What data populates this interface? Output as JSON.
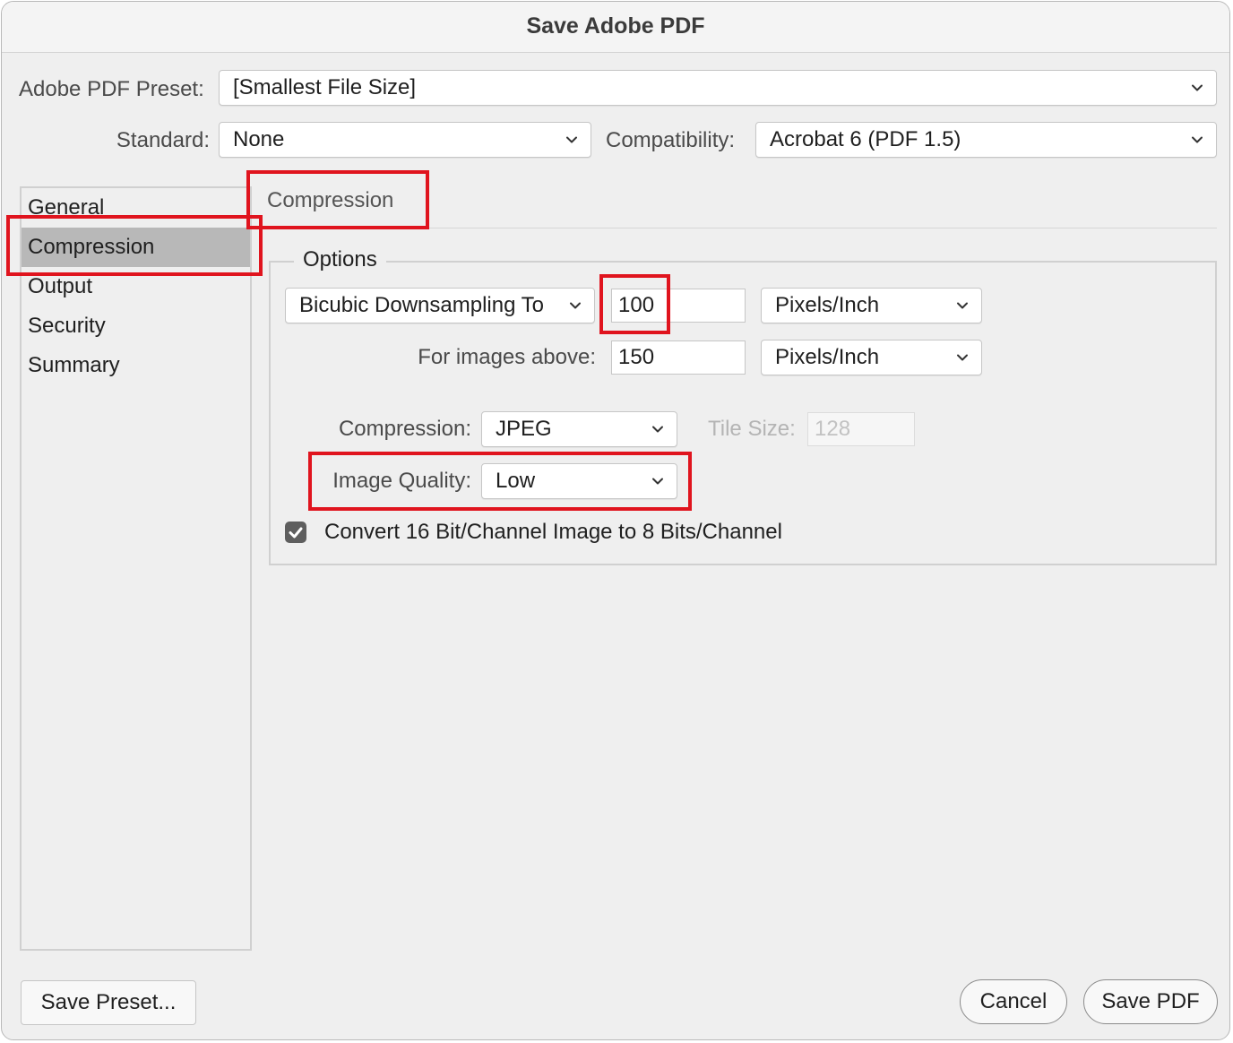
{
  "window": {
    "title": "Save Adobe PDF"
  },
  "preset": {
    "label": "Adobe PDF Preset:",
    "value": "[Smallest File Size]"
  },
  "standard": {
    "label": "Standard:",
    "value": "None"
  },
  "compatibility": {
    "label": "Compatibility:",
    "value": "Acrobat 6 (PDF 1.5)"
  },
  "sidebar": {
    "items": [
      {
        "label": "General"
      },
      {
        "label": "Compression"
      },
      {
        "label": "Output"
      },
      {
        "label": "Security"
      },
      {
        "label": "Summary"
      }
    ],
    "selected": "Compression"
  },
  "section": {
    "title": "Compression"
  },
  "options": {
    "legend": "Options",
    "downsampling": {
      "value": "Bicubic Downsampling To",
      "resolution": "100",
      "unit": "Pixels/Inch"
    },
    "images_above": {
      "label": "For images above:",
      "value": "150",
      "unit": "Pixels/Inch"
    },
    "compression": {
      "label": "Compression:",
      "value": "JPEG"
    },
    "tile_size": {
      "label": "Tile Size:",
      "value": "128"
    },
    "image_quality": {
      "label": "Image Quality:",
      "value": "Low"
    },
    "convert_16bit": {
      "label": "Convert 16 Bit/Channel Image to 8 Bits/Channel",
      "checked": true
    }
  },
  "buttons": {
    "save_preset": "Save Preset...",
    "cancel": "Cancel",
    "save_pdf": "Save PDF"
  },
  "colors": {
    "highlight": "#e0141e",
    "selected_row": "#b8b8b8"
  }
}
